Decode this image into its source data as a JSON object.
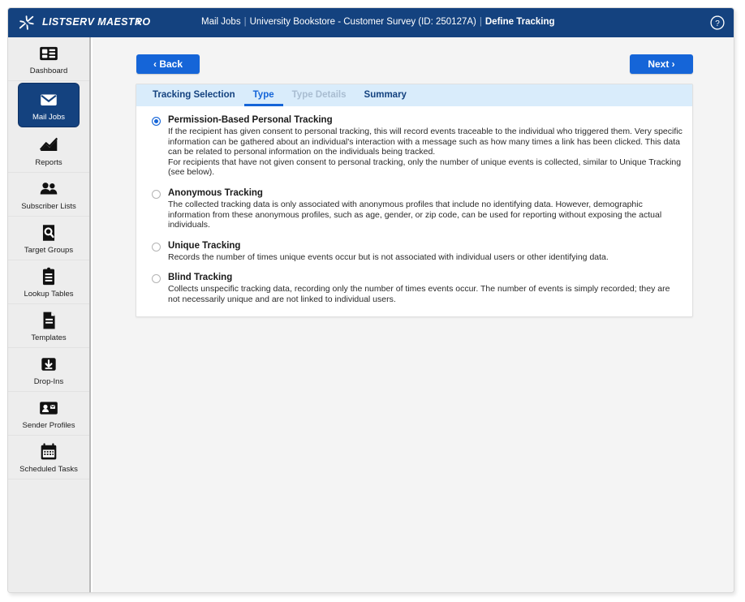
{
  "topbar": {
    "logo_icon": "star-logo-icon",
    "brand": "LISTSERV MAESTRO",
    "brand_chevron": "›",
    "breadcrumb": {
      "item1": "Mail Jobs",
      "item2": "University Bookstore - Customer Survey (ID: 250127A)",
      "current": "Define Tracking",
      "separator": "|"
    },
    "help_icon": "help-circle-icon",
    "bg_color": "#14427f"
  },
  "sidebar": {
    "items": [
      {
        "label": "Dashboard",
        "icon": "dashboard-icon",
        "active": false
      },
      {
        "label": "Mail Jobs",
        "icon": "envelope-icon",
        "active": true
      },
      {
        "label": "Reports",
        "icon": "chart-line-icon",
        "active": false
      },
      {
        "label": "Subscriber Lists",
        "icon": "people-icon",
        "active": false
      },
      {
        "label": "Target Groups",
        "icon": "target-search-icon",
        "active": false
      },
      {
        "label": "Lookup Tables",
        "icon": "clipboard-icon",
        "active": false
      },
      {
        "label": "Templates",
        "icon": "document-icon",
        "active": false
      },
      {
        "label": "Drop-Ins",
        "icon": "download-box-icon",
        "active": false
      },
      {
        "label": "Sender Profiles",
        "icon": "contact-card-icon",
        "active": false
      },
      {
        "label": "Scheduled Tasks",
        "icon": "calendar-icon",
        "active": false
      }
    ]
  },
  "toolbar": {
    "back_label": "‹ Back",
    "next_label": "Next ›",
    "button_color": "#1565d8"
  },
  "tabs": [
    {
      "label": "Tracking Selection",
      "state": "normal"
    },
    {
      "label": "Type",
      "state": "active"
    },
    {
      "label": "Type Details",
      "state": "disabled"
    },
    {
      "label": "Summary",
      "state": "normal"
    }
  ],
  "options": [
    {
      "title": "Permission-Based Personal Tracking",
      "selected": true,
      "desc1": "If the recipient has given consent to personal tracking, this will record events traceable to the individual who triggered them. Very specific information can be gathered about an individual's interaction with a message such as how many times a link has been clicked. This data can be related to personal information on the individuals being tracked.",
      "desc2": "For recipients that have not given consent to personal tracking, only the number of unique events is collected, similar to Unique Tracking (see below)."
    },
    {
      "title": "Anonymous Tracking",
      "selected": false,
      "desc1": "The collected tracking data is only associated with anonymous profiles that include no identifying data. However, demographic information from these anonymous profiles, such as age, gender, or zip code, can be used for reporting without exposing the actual individuals.",
      "desc2": ""
    },
    {
      "title": "Unique Tracking",
      "selected": false,
      "desc1": "Records the number of times unique events occur but is not associated with individual users or other identifying data.",
      "desc2": ""
    },
    {
      "title": "Blind Tracking",
      "selected": false,
      "desc1": "Collects unspecific tracking data, recording only the number of times events occur. The number of events is simply recorded; they are not necessarily unique and are not linked to individual users.",
      "desc2": ""
    }
  ]
}
